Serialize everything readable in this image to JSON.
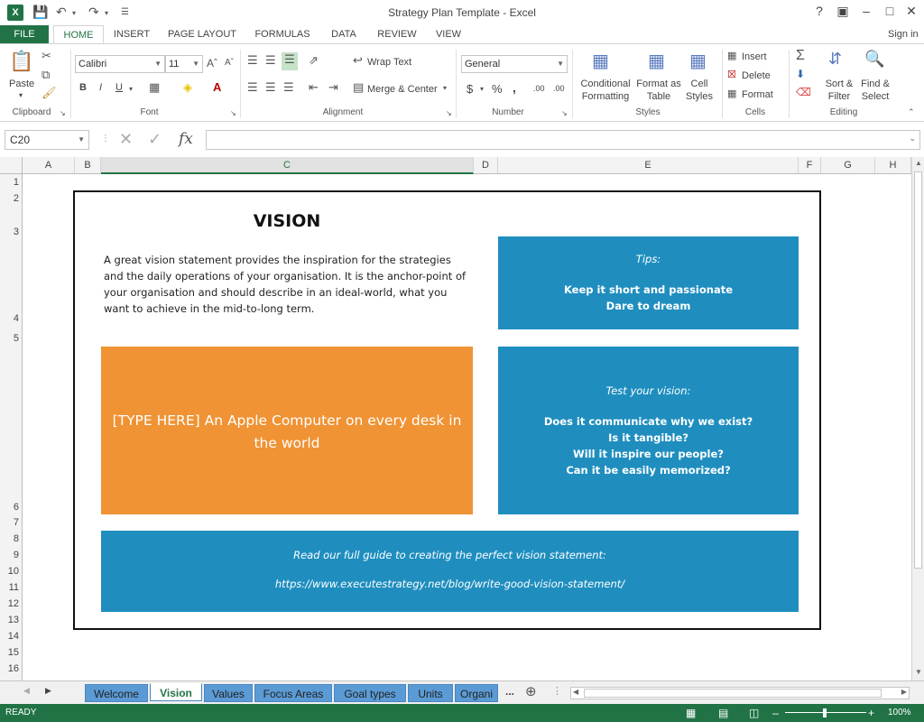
{
  "window": {
    "title": "Strategy Plan Template - Excel",
    "help": "?",
    "sign_in": "Sign in"
  },
  "ribbon_tabs": [
    "FILE",
    "HOME",
    "INSERT",
    "PAGE LAYOUT",
    "FORMULAS",
    "DATA",
    "REVIEW",
    "VIEW"
  ],
  "ribbon": {
    "paste": "Paste",
    "font_name": "Calibri",
    "font_size": "11",
    "bold": "B",
    "italic": "I",
    "underline": "U",
    "wrap_text": "Wrap Text",
    "merge_center": "Merge & Center",
    "number_format": "General",
    "currency": "$",
    "percent": "%",
    "comma": ",",
    "dec_inc": ".00",
    "dec_dec": ".00",
    "conditional_formatting_1": "Conditional",
    "conditional_formatting_2": "Formatting",
    "format_as_table_1": "Format as",
    "format_as_table_2": "Table",
    "cell_styles_1": "Cell",
    "cell_styles_2": "Styles",
    "insert": "Insert",
    "delete": "Delete",
    "format": "Format",
    "sort_filter_1": "Sort &",
    "sort_filter_2": "Filter",
    "find_select_1": "Find &",
    "find_select_2": "Select",
    "groups": {
      "clipboard": "Clipboard",
      "font": "Font",
      "alignment": "Alignment",
      "number": "Number",
      "styles": "Styles",
      "cells": "Cells",
      "editing": "Editing"
    }
  },
  "formula_bar": {
    "name_box": "C20",
    "fx": "fx",
    "content": ""
  },
  "columns": [
    "A",
    "B",
    "C",
    "D",
    "E",
    "F",
    "G",
    "H"
  ],
  "rows": [
    "1",
    "2",
    "3",
    "4",
    "5",
    "6",
    "7",
    "8",
    "9",
    "10",
    "11",
    "12",
    "13",
    "14",
    "15",
    "16"
  ],
  "vision": {
    "title": "VISION",
    "intro": "A great vision statement provides the inspiration for the strategies and the daily operations of your organisation. It is the anchor-point of your organisation and should describe in an ideal-world, what you want to achieve in the mid-to-long term.",
    "statement": "[TYPE HERE] An Apple Computer on every desk in the world",
    "tips_heading": "Tips:",
    "tips": [
      "Keep it short and passionate",
      "Dare to dream"
    ],
    "test_heading": "Test your vision:",
    "test_questions": [
      "Does it communicate why we exist?",
      "Is it tangible?",
      "Will it inspire our people?",
      "Can it be easily memorized?"
    ],
    "guide_heading": "Read our full guide to creating the perfect vision statement:",
    "guide_url": "https://www.executestrategy.net/blog/write-good-vision-statement/"
  },
  "sheet_tabs": [
    "Welcome",
    "Vision",
    "Values",
    "Focus Areas",
    "Goal types",
    "Units",
    "Organi"
  ],
  "sheet_more": "...",
  "status": {
    "mode": "READY",
    "zoom": "100%"
  },
  "colors": {
    "excel_green": "#217346",
    "orange": "#ef9334",
    "blue": "#1f8ebf",
    "sheet_tab_blue": "#5b9bd5"
  }
}
